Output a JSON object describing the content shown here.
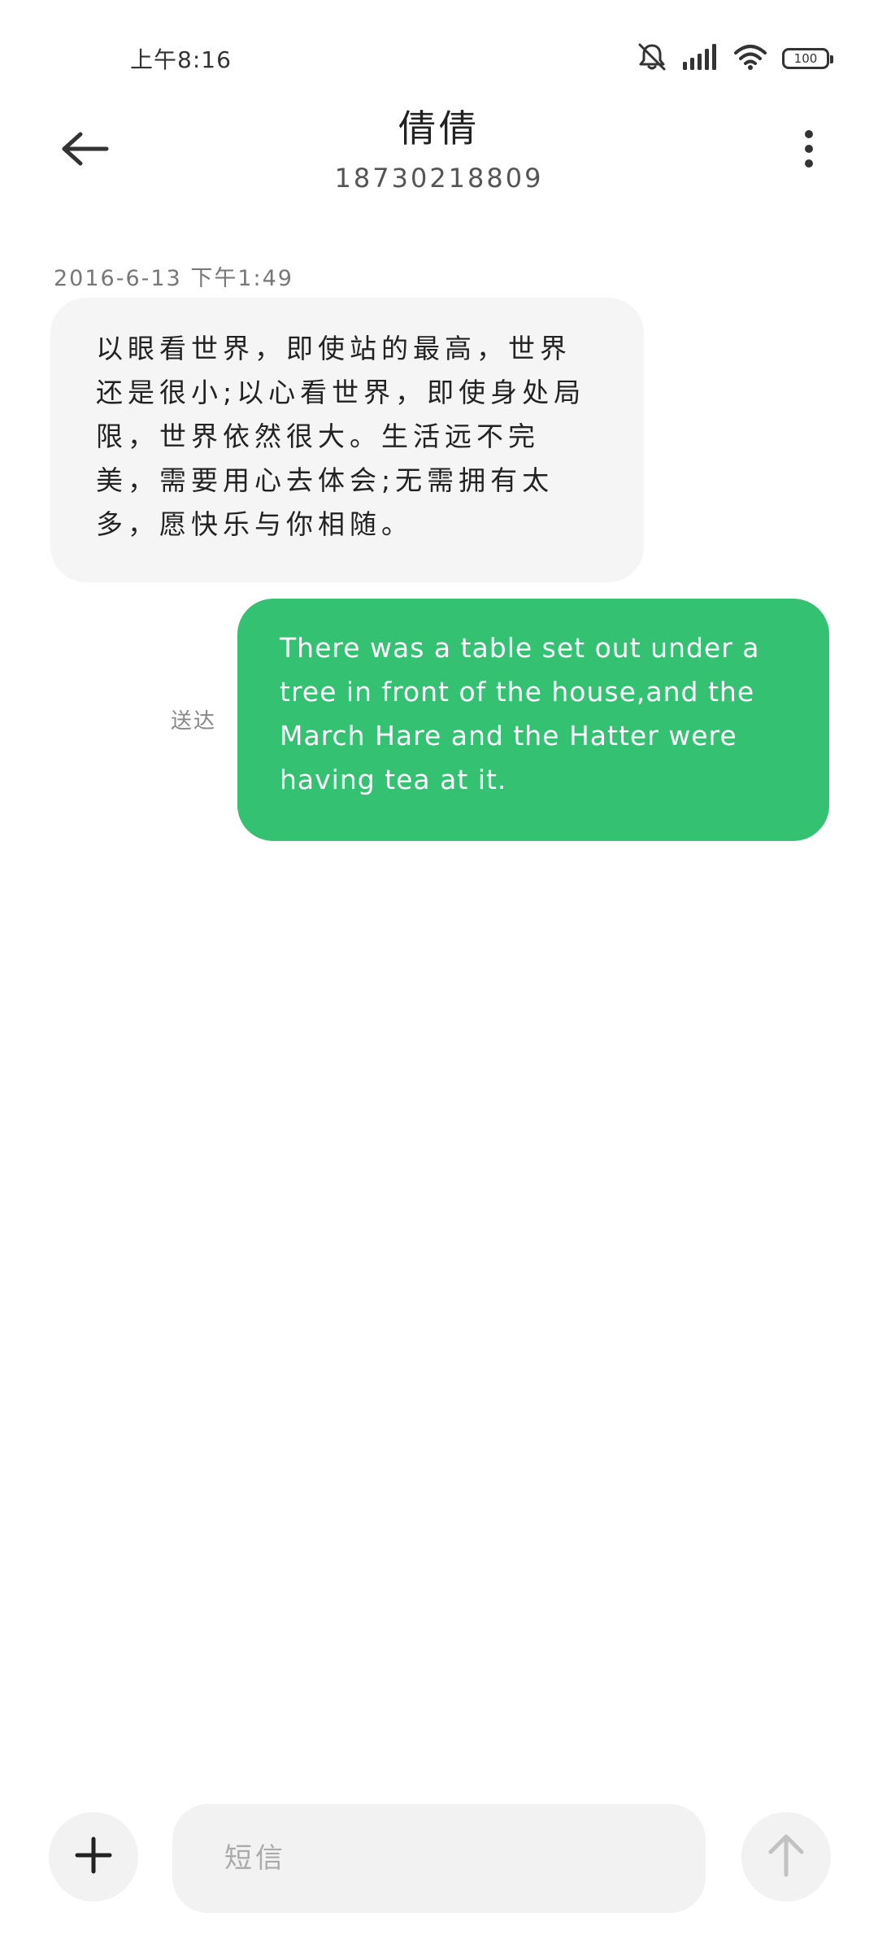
{
  "status_bar": {
    "time": "上午8:16",
    "battery_level": "100",
    "icons": [
      "mute-bell-icon",
      "signal-icon",
      "wifi-icon",
      "battery-icon"
    ]
  },
  "header": {
    "contact_name": "倩倩",
    "contact_number": "18730218809",
    "icons": [
      "back-arrow-icon",
      "more-vertical-icon"
    ]
  },
  "messages": [
    {
      "direction": "incoming",
      "timestamp": "2016-6-13 下午1:49",
      "text": "以眼看世界，即使站的最高，世界还是很小;以心看世界，即使身处局限，世界依然很大。生活远不完美，需要用心去体会;无需拥有太多，愿快乐与你相随。"
    },
    {
      "direction": "outgoing",
      "status": "送达",
      "text": "There was a table set out under a tree in front of the house,and the March Hare and the Hatter were having tea at it."
    }
  ],
  "input_bar": {
    "placeholder": "短信",
    "value": "",
    "icons": [
      "plus-icon",
      "send-arrow-icon"
    ]
  },
  "colors": {
    "outgoing_bubble": "#35c172",
    "incoming_bubble": "#f5f5f5",
    "input_background": "#f2f2f2"
  }
}
